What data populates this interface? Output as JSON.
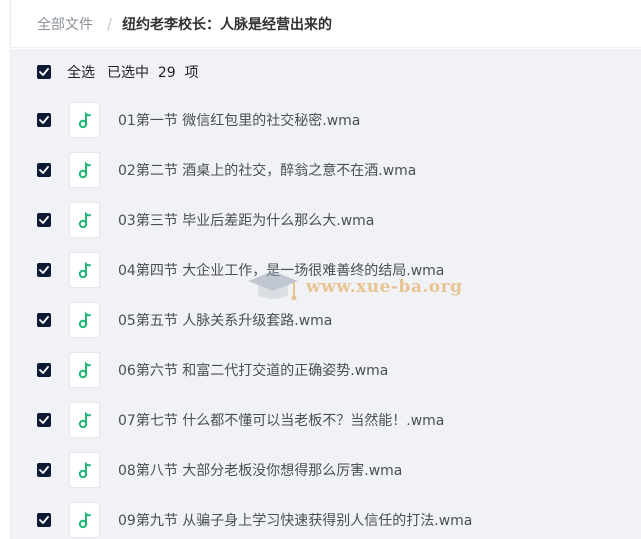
{
  "breadcrumb": {
    "root": "全部文件",
    "separator": "/",
    "current": "纽约老李校长：人脉是经营出来的"
  },
  "selection": {
    "select_all_label": "全选",
    "selected_text": "已选中  29  项"
  },
  "files": [
    {
      "name": "01第一节 微信红包里的社交秘密.wma",
      "checked": true
    },
    {
      "name": "02第二节 酒桌上的社交，醉翁之意不在酒.wma",
      "checked": true
    },
    {
      "name": "03第三节 毕业后差距为什么那么大.wma",
      "checked": true
    },
    {
      "name": "04第四节 大企业工作，是一场很难善终的结局.wma",
      "checked": true
    },
    {
      "name": "05第五节 人脉关系升级套路.wma",
      "checked": true
    },
    {
      "name": "06第六节 和富二代打交道的正确姿势.wma",
      "checked": true
    },
    {
      "name": "07第七节 什么都不懂可以当老板不？当然能！.wma",
      "checked": true
    },
    {
      "name": "08第八节 大部分老板没你想得那么厉害.wma",
      "checked": true
    },
    {
      "name": "09第九节 从骗子身上学习快速获得别人信任的打法.wma",
      "checked": true
    }
  ],
  "watermark": "www.xue-ba.org",
  "colors": {
    "checkbox": "#0d1a33",
    "music_icon": "#22b573",
    "list_bg": "#f1f2f5"
  },
  "icons": {
    "file": "music-note-icon",
    "check": "checkmark-icon"
  }
}
